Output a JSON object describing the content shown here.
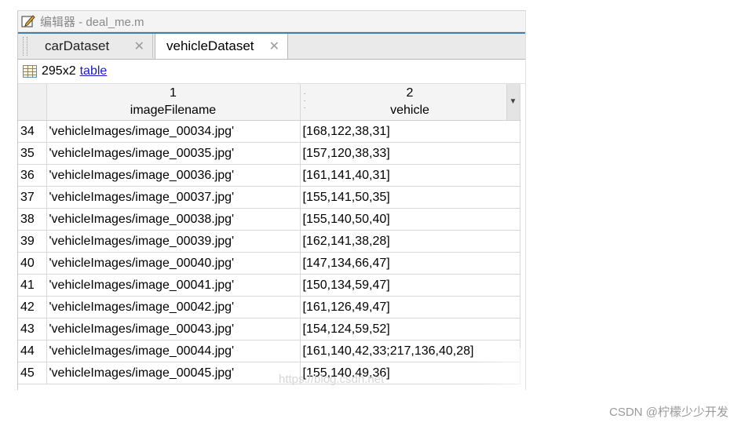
{
  "window": {
    "title": "编辑器 - deal_me.m"
  },
  "tabs": [
    {
      "label": "carDataset",
      "active": false,
      "close": "✕"
    },
    {
      "label": "vehicleDataset",
      "active": true,
      "close": "✕"
    }
  ],
  "info": {
    "size": "295x2",
    "type_link": "table"
  },
  "columns": [
    {
      "index": "1",
      "name": "imageFilename"
    },
    {
      "index": "2",
      "name": "vehicle"
    }
  ],
  "rows": [
    {
      "n": "34",
      "file": "'vehicleImages/image_00034.jpg'",
      "box": "[168,122,38,31]"
    },
    {
      "n": "35",
      "file": "'vehicleImages/image_00035.jpg'",
      "box": "[157,120,38,33]"
    },
    {
      "n": "36",
      "file": "'vehicleImages/image_00036.jpg'",
      "box": "[161,141,40,31]"
    },
    {
      "n": "37",
      "file": "'vehicleImages/image_00037.jpg'",
      "box": "[155,141,50,35]"
    },
    {
      "n": "38",
      "file": "'vehicleImages/image_00038.jpg'",
      "box": "[155,140,50,40]"
    },
    {
      "n": "39",
      "file": "'vehicleImages/image_00039.jpg'",
      "box": "[162,141,38,28]"
    },
    {
      "n": "40",
      "file": "'vehicleImages/image_00040.jpg'",
      "box": "[147,134,66,47]"
    },
    {
      "n": "41",
      "file": "'vehicleImages/image_00041.jpg'",
      "box": "[150,134,59,47]"
    },
    {
      "n": "42",
      "file": "'vehicleImages/image_00042.jpg'",
      "box": "[161,126,49,47]"
    },
    {
      "n": "43",
      "file": "'vehicleImages/image_00043.jpg'",
      "box": "[154,124,59,52]"
    },
    {
      "n": "44",
      "file": "'vehicleImages/image_00044.jpg'",
      "box": "[161,140,42,33;217,136,40,28]"
    },
    {
      "n": "45",
      "file": "'vehicleImages/image_00045.jpg'",
      "box": "[155,140,49,36]"
    }
  ],
  "watermark": "https://blog.csdn.net",
  "footer": {
    "credit": "CSDN @柠檬少少开发"
  },
  "icons": {
    "title": "edit-pencil-icon",
    "grid": "table-grid-icon",
    "dropdown": "dropdown-arrow-icon"
  }
}
